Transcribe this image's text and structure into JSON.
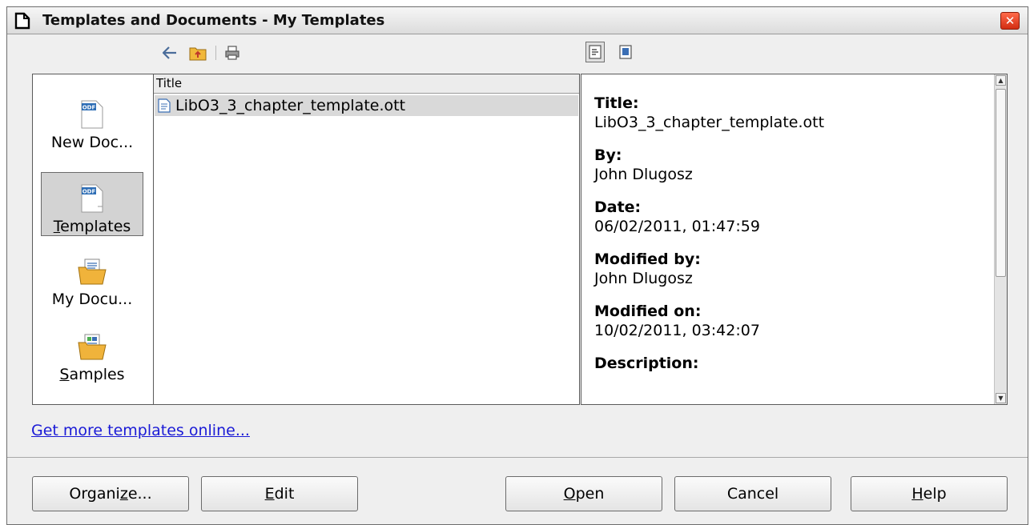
{
  "window": {
    "title": "Templates and Documents - My Templates",
    "close_glyph": "✕"
  },
  "toolbar": {
    "icons": [
      "back-arrow-icon",
      "up-folder-icon",
      "print-icon"
    ],
    "view_icons": [
      "preview-properties-icon",
      "preview-document-icon"
    ]
  },
  "categories": [
    {
      "label": "New Doc...",
      "underline_char": "",
      "rest": "",
      "icon": "odf-document-icon"
    },
    {
      "label_under": "T",
      "label_rest": "emplates",
      "icon": "odf-template-icon",
      "selected": true
    },
    {
      "label": "My Docu...",
      "icon": "documents-folder-icon"
    },
    {
      "label_under": "S",
      "label_rest": "amples",
      "icon": "samples-folder-icon"
    }
  ],
  "list": {
    "column_header": "Title",
    "items": [
      {
        "name": "LibO3_3_chapter_template.ott",
        "selected": true
      }
    ]
  },
  "info": {
    "fields": [
      {
        "label": "Title:",
        "value": "LibO3_3_chapter_template.ott"
      },
      {
        "label": "By:",
        "value": "John Dlugosz"
      },
      {
        "label": "Date:",
        "value": "06/02/2011, 01:47:59"
      },
      {
        "label": "Modified by:",
        "value": "John Dlugosz"
      },
      {
        "label": "Modified on:",
        "value": "10/02/2011, 03:42:07"
      },
      {
        "label": "Description:",
        "value": ""
      }
    ]
  },
  "link_text": "Get more templates online...",
  "buttons": {
    "organize": {
      "pre": "Organi",
      "under": "z",
      "post": "e..."
    },
    "edit": {
      "pre": "",
      "under": "E",
      "post": "dit"
    },
    "open": {
      "pre": "",
      "under": "O",
      "post": "pen"
    },
    "cancel": {
      "label": "Cancel"
    },
    "help": {
      "pre": "",
      "under": "H",
      "post": "elp"
    }
  },
  "colors": {
    "link": "#1a1ad6",
    "close_button": "#d22d12",
    "selection": "#d9d9d9"
  }
}
